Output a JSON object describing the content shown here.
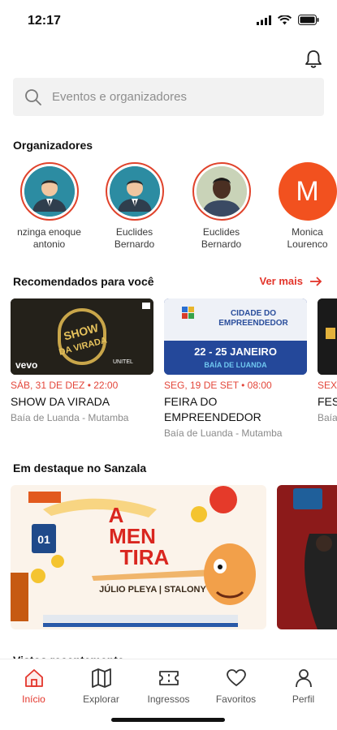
{
  "status": {
    "time": "12:17"
  },
  "search": {
    "placeholder": "Eventos e organizadores"
  },
  "organizers": {
    "title": "Organizadores",
    "items": [
      {
        "line1": "nzinga enoque",
        "line2": "antonio",
        "avatar": "person-avatar"
      },
      {
        "line1": "Euclides",
        "line2": "Bernardo",
        "avatar": "person-avatar"
      },
      {
        "line1": "Euclides",
        "line2": "Bernardo",
        "avatar": "photo-avatar"
      },
      {
        "line1": "Monica",
        "line2": "Lourenco",
        "avatar_letter": "M"
      }
    ]
  },
  "recommended": {
    "title": "Recomendados para você",
    "see_more": "Ver mais",
    "items": [
      {
        "date": "SÁB, 31 DE DEZ • 22:00",
        "title": "SHOW DA VIRADA",
        "location": "Baía de Luanda - Mutamba",
        "poster_text": "SHOW DA VIRADA",
        "poster_brand": "vevo",
        "poster_sponsor": "UNITEL"
      },
      {
        "date": "SEG, 19 DE SET • 08:00",
        "title": "FEIRA DO EMPREENDEDOR",
        "location": "Baía de Luanda - Mutamba",
        "poster_line1": "CIDADE DO",
        "poster_line2": "EMPREENDEDOR",
        "poster_dates": "22 - 25 JANEIRO",
        "poster_place": "BAÍA DE LUANDA"
      },
      {
        "date": "SEX",
        "title": "FES",
        "location": "Baía"
      }
    ]
  },
  "featured": {
    "title": "Em destaque no Sanzala",
    "poster_title_1": "A",
    "poster_title_2": "MEN",
    "poster_title_3": "TIRA",
    "poster_day": "01",
    "poster_names": "JÚLIO PLEYA | STALONY"
  },
  "recent": {
    "title": "Vistos recentemente"
  },
  "nav": {
    "items": [
      {
        "label": "Início",
        "active": true
      },
      {
        "label": "Explorar"
      },
      {
        "label": "Ingressos"
      },
      {
        "label": "Favoritos"
      },
      {
        "label": "Perfil"
      }
    ]
  },
  "colors": {
    "accent": "#e3352b",
    "date": "#e3463a",
    "ring": "#e0432c"
  }
}
